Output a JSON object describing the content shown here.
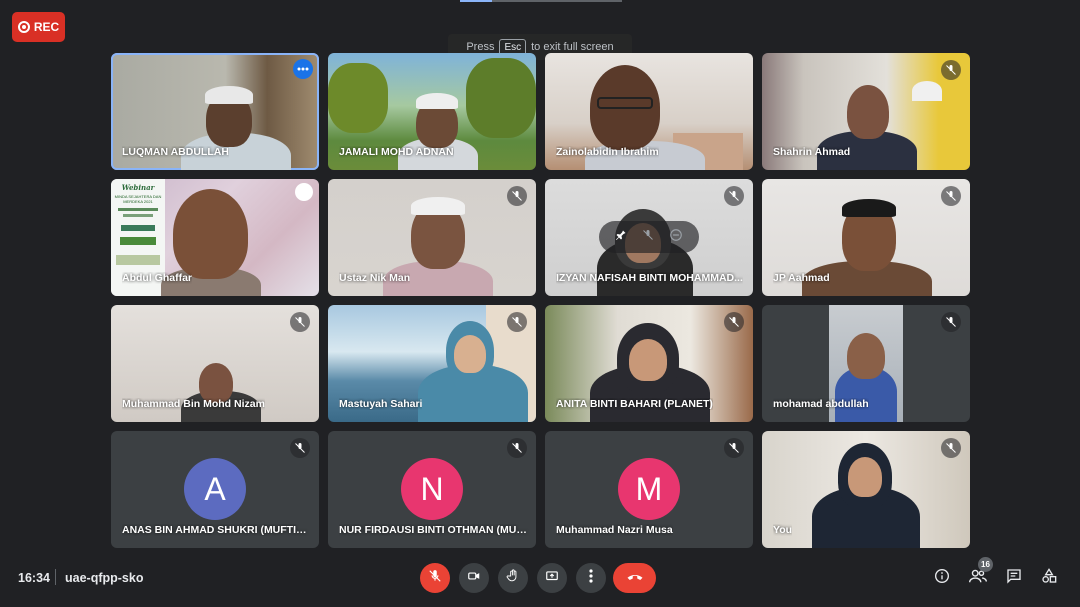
{
  "recording": {
    "label": "REC"
  },
  "fullscreen_hint": {
    "prefix": "Press",
    "key": "Esc",
    "suffix": "to exit full screen"
  },
  "participants": [
    {
      "name": "LUQMAN ABDULLAH",
      "muted": false,
      "speaking": true,
      "video": true
    },
    {
      "name": "JAMALI MOHD ADNAN",
      "muted": false,
      "video": true
    },
    {
      "name": "Zainolabidin Ibrahim",
      "muted": false,
      "video": true
    },
    {
      "name": "Shahrin Ahmad",
      "muted": true,
      "video": true
    },
    {
      "name": "Abdul Ghaffar",
      "muted": false,
      "video": true,
      "poster": {
        "title": "Webinar",
        "subtitle": "MINDA SEJAHTERA DAN MERDEKA 2021"
      }
    },
    {
      "name": "Ustaz Nik Man",
      "muted": true,
      "video": true
    },
    {
      "name": "IZYAN NAFISAH BINTI MOHAMMAD...",
      "muted": true,
      "video": true
    },
    {
      "name": "JP Aahmad",
      "muted": true,
      "video": true
    },
    {
      "name": "Muhammad Bin Mohd Nizam",
      "muted": true,
      "video": true
    },
    {
      "name": "Mastuyah Sahari",
      "muted": true,
      "video": true
    },
    {
      "name": "ANITA BINTI BAHARI (PLANET)",
      "muted": true,
      "video": true
    },
    {
      "name": "mohamad abdullah",
      "muted": true,
      "video": true
    },
    {
      "name": "ANAS BIN AHMAD SHUKRI (MUFTIWP)",
      "muted": true,
      "video": false,
      "initial": "A",
      "avatar_color": "#5c6bc0"
    },
    {
      "name": "NUR FIRDAUSI BINTI OTHMAN (MUFT...",
      "muted": true,
      "video": false,
      "initial": "N",
      "avatar_color": "#e8366f"
    },
    {
      "name": "Muhammad Nazri Musa",
      "muted": true,
      "video": false,
      "initial": "M",
      "avatar_color": "#e8366f"
    },
    {
      "name": "You",
      "muted": true,
      "video": true
    }
  ],
  "footer": {
    "time": "16:34",
    "meeting_code": "uae-qfpp-sko",
    "participant_count": "16"
  },
  "controls": [
    "mic-off-icon",
    "camera-icon",
    "raise-hand-icon",
    "present-screen-icon",
    "more-options-icon",
    "end-call-icon"
  ],
  "right_controls": [
    "info-icon",
    "people-icon",
    "chat-icon",
    "activities-icon"
  ],
  "colors": {
    "background": "#202124",
    "tile": "#3c4043",
    "accent": "#8ab4f8",
    "danger": "#ea4335"
  }
}
